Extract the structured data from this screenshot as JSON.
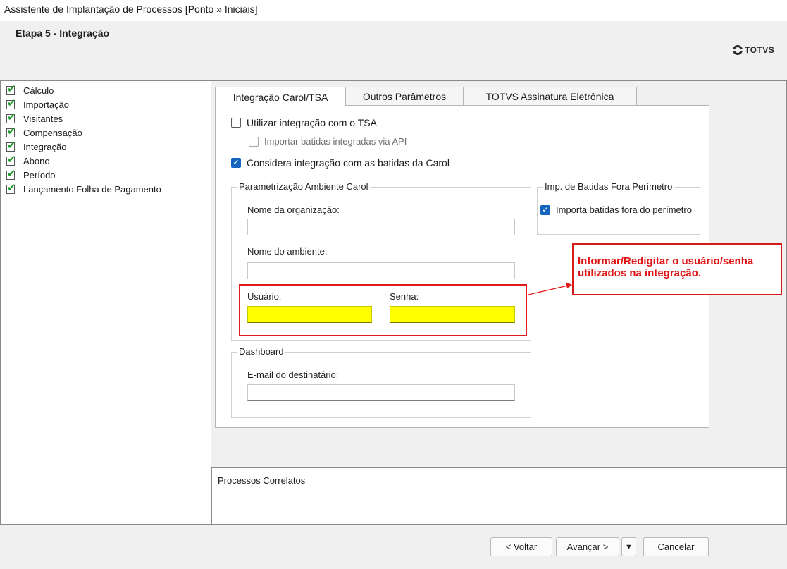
{
  "window": {
    "title": "Assistente de Implantação de Processos [Ponto » Iniciais]"
  },
  "header": {
    "step_title": "Etapa 5 - Integração",
    "logo_text": "TOTVS"
  },
  "steps": [
    {
      "label": "Cálculo",
      "icon": "checked-page-icon"
    },
    {
      "label": "Importação",
      "icon": "checked-page-icon"
    },
    {
      "label": "Visitantes",
      "icon": "checked-page-icon"
    },
    {
      "label": "Compensação",
      "icon": "checked-page-icon"
    },
    {
      "label": "Integração",
      "icon": "checked-page-icon",
      "selected": true
    },
    {
      "label": "Abono",
      "icon": "checked-page-icon"
    },
    {
      "label": "Período",
      "icon": "checked-page-icon"
    },
    {
      "label": "Lançamento Folha de Pagamento",
      "icon": "checked-page-icon"
    }
  ],
  "tabs": [
    {
      "label": "Integração Carol/TSA",
      "active": true
    },
    {
      "label": "Outros Parâmetros",
      "active": false
    },
    {
      "label": "TOTVS Assinatura Eletrônica",
      "active": false
    }
  ],
  "options": {
    "use_tsa": {
      "label": "Utilizar integração com o TSA",
      "checked": false
    },
    "import_api": {
      "label": "Importar batidas integradas via API",
      "checked": false,
      "enabled": false
    },
    "consider_carol": {
      "label": "Considera integração com as batidas da Carol",
      "checked": true
    }
  },
  "carol_group": {
    "title": "Parametrização Ambiente Carol",
    "org_label": "Nome da organização:",
    "org_value": "",
    "env_label": "Nome do ambiente:",
    "env_value": "",
    "user_label": "Usuário:",
    "user_value": "",
    "password_label": "Senha:",
    "password_value": ""
  },
  "perimeter_group": {
    "title": "Imp. de Batidas Fora Perímetro",
    "checkbox_label": "Importa batidas fora do perímetro",
    "checked": true
  },
  "dashboard_group": {
    "title": "Dashboard",
    "email_label": "E-mail do destinatário:",
    "email_value": ""
  },
  "annotation": {
    "line1": "Informar/Redigitar o usuário/senha",
    "line2": "utilizados na integração."
  },
  "related": {
    "title": "Processos Correlatos"
  },
  "buttons": {
    "back": "< Voltar",
    "next": "Avançar >",
    "cancel": "Cancelar"
  },
  "colors": {
    "highlight": "#ffff00",
    "annotation": "#e11b1b",
    "checked": "#1565c0"
  }
}
